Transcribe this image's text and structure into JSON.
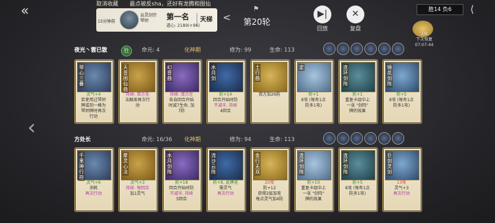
{
  "header": {
    "ticker_left": "取消收藏",
    "ticker_mid": "最点被反sha，还好有龙腾和图仙",
    "ticker_user": "",
    "realm": "15分钟前",
    "player_name": "云灵剑宗",
    "player_sub": "琴师",
    "rank": "第一名",
    "score": "道心: 2189(+96)",
    "ladder": "天梯",
    "round": "第20轮",
    "review_label": "回放",
    "replay_label": "复盘",
    "winloss": "胜14  负6",
    "timer_badge": "",
    "timer_line1": "2/8",
    "timer_line2": "下次恢复",
    "timer_line3": "07:07:44"
  },
  "players": [
    {
      "name": "夜光丶雲已散",
      "result": "胜",
      "destiny": "命元: 4",
      "realm": "化神期",
      "cultivation": "修为: 99",
      "life": "生命: 113",
      "cards": [
        {
          "title": "琴心三叠",
          "level": "",
          "lines": [
            "灵气+4",
            "若使用过琴师",
            "牌或到一格为",
            "琴师牌时再次",
            "行动"
          ]
        },
        {
          "title": "天音困仙曲",
          "level": "",
          "lines": [
            "持续: 双方无",
            "法触发再次行",
            "动"
          ]
        },
        {
          "title": "幻音曲",
          "level": "",
          "lines": [
            "持续: 双方在",
            "各自回合开始",
            "时减7生命, 加",
            "7防"
          ]
        },
        {
          "title": "水月剑",
          "level": "",
          "lines": [
            "防+14",
            "回合开始时防",
            "不减半, 持续",
            "4回合"
          ]
        },
        {
          "title": "土行曲",
          "level": "",
          "lines": [
            "双方加26防"
          ]
        },
        {
          "title": "定",
          "level": "",
          "lines": [
            "防+1",
            "8攻 (每有1点",
            "防多1攻)"
          ]
        },
        {
          "title": "连环剑阵",
          "level": "",
          "lines": [
            "防+1",
            "重复卡组中上",
            "一张 \"剑阵\"",
            "牌的效果"
          ]
        },
        {
          "title": "镜花剑阵",
          "level": "",
          "lines": [
            "防+5",
            "8攻 (每有1点",
            "防多1攻)"
          ]
        }
      ]
    },
    {
      "name": "方处长",
      "result": "",
      "destiny": "命元: 16/36",
      "realm": "化神期",
      "cultivation": "修为: 94",
      "life": "生命: 113",
      "cards": [
        {
          "title": "千里神行符",
          "level": "",
          "lines": [
            "灵气+6",
            "消耗",
            "再次行动"
          ]
        },
        {
          "title": "聚灵心法",
          "level": "",
          "lines": [
            "灵气+3",
            "持续: 每回合",
            "加1灵气"
          ]
        },
        {
          "title": "水月剑阵",
          "level": "",
          "lines": [
            "防+18",
            "回合开始时防",
            "不减半, 持续",
            "5回合"
          ]
        },
        {
          "title": "流沙云阵",
          "level": "",
          "lines": [
            "防+8, 此牌无",
            "需灵气",
            "再次行动"
          ]
        },
        {
          "title": "金行无双",
          "level": "",
          "lines": [
            "20攻",
            "防+12",
            "获得2层加攻",
            "每点灵气加4防"
          ]
        },
        {
          "title": "连环剑阵",
          "level": "",
          "lines": [
            "防+10",
            "重复卡组中上",
            "一张 \"剑阵\"",
            "牌的效果"
          ]
        },
        {
          "title": "连环剑阵",
          "level": "",
          "lines": [
            "防+5",
            "8攻 (每有1点",
            "防多1攻)"
          ]
        },
        {
          "title": "巨剑灵剑",
          "level": "",
          "lines": [
            "13攻",
            "灵气+3",
            "再次行动"
          ]
        }
      ]
    }
  ],
  "colors": {
    "accent_gold": "#e2c06a",
    "win_green": "#6fae6b",
    "gain_green": "#2f8a2f",
    "attack_red": "#c43",
    "persist_magenta": "#b03aa0"
  }
}
